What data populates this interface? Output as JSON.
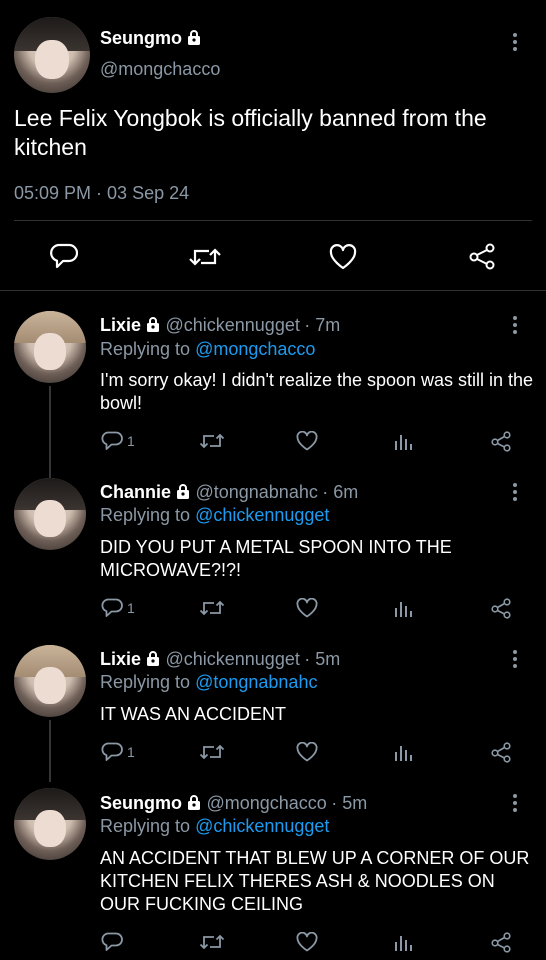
{
  "main_tweet": {
    "display_name": "Seungmo",
    "handle": "@mongchacco",
    "text": "Lee Felix Yongbok is officially banned from the kitchen",
    "timestamp": "05:09 PM · 03 Sep 24",
    "actions": [
      "reply-icon",
      "retweet-icon",
      "like-icon",
      "share-icon"
    ]
  },
  "replies": [
    {
      "display_name": "Lixie",
      "handle": "@chickennugget",
      "time": "· 7m",
      "replying_prefix": "Replying to",
      "replying_to": "@mongchacco",
      "text": "I'm sorry okay! I didn't realize the spoon was still in the bowl!",
      "reply_count": "1"
    },
    {
      "display_name": "Channie",
      "handle": "@tongnabnahc",
      "time": "· 6m",
      "replying_prefix": "Replying to",
      "replying_to": "@chickennugget",
      "text": "DID YOU PUT A METAL SPOON INTO THE MICROWAVE?!?!",
      "reply_count": "1"
    },
    {
      "display_name": "Lixie",
      "handle": "@chickennugget",
      "time": "· 5m",
      "replying_prefix": "Replying to",
      "replying_to": "@tongnabnahc",
      "text": "IT WAS AN ACCIDENT",
      "reply_count": "1"
    },
    {
      "display_name": "Seungmo",
      "handle": "@mongchacco",
      "time": "· 5m",
      "replying_prefix": "Replying to",
      "replying_to": "@chickennugget",
      "text": "AN ACCIDENT THAT BLEW UP A CORNER OF OUR KITCHEN FELIX THERES ASH & NOODLES ON OUR FUCKING CEILING",
      "reply_count": ""
    }
  ],
  "colors": {
    "background": "#000000",
    "secondary_text": "#8b98a5",
    "link": "#1d9bf0",
    "divider": "#2f3336"
  }
}
